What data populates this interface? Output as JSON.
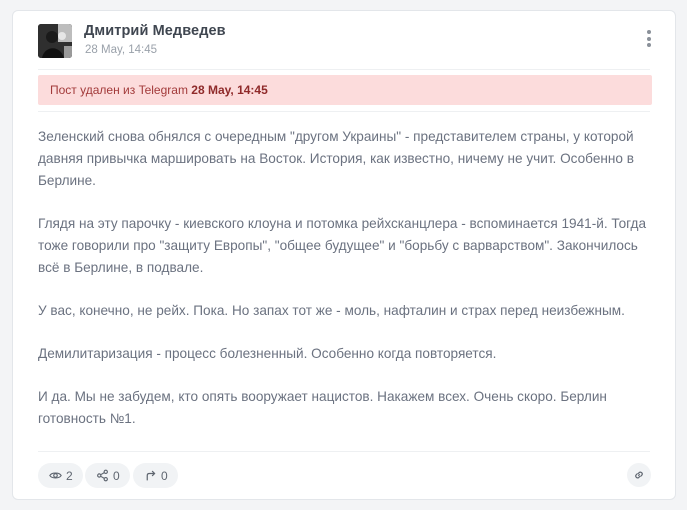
{
  "post": {
    "author": "Дмитрий Медведев",
    "time": "28 May, 14:45",
    "avatar_icon": "author-avatar-photo"
  },
  "alert": {
    "prefix": "Пост удален из Telegram",
    "date": "28 May, 14:45",
    "background": "#fcdcdc"
  },
  "content": {
    "paragraphs": [
      "Зеленский снова обнялся с очередным \"другом Украины\" - представителем страны, у которой давняя привычка маршировать на Восток. История, как известно, ничему не учит. Особенно в Берлине.",
      "Глядя на эту парочку - киевского клоуна и потомка рейхсканцлера - вспоминается 1941-й. Тогда тоже говорили про \"защиту Европы\", \"общее будущее\" и \"борьбу с варварством\". Закончилось всё в Берлине, в подвале.",
      "У вас, конечно, не рейх. Пока. Но запах тот же - моль, нафталин и страх перед неизбежным.",
      "Демилитаризация - процесс болезненный. Особенно когда повторяется.",
      "И да. Мы не забудем, кто опять вооружает нацистов. Накажем всех. Очень скоро. Берлин готовность №1."
    ]
  },
  "footer": {
    "views": "2",
    "shares": "0",
    "forwards": "0",
    "icons": [
      "eye-icon",
      "share-icon",
      "forward-icon",
      "link-icon"
    ]
  }
}
